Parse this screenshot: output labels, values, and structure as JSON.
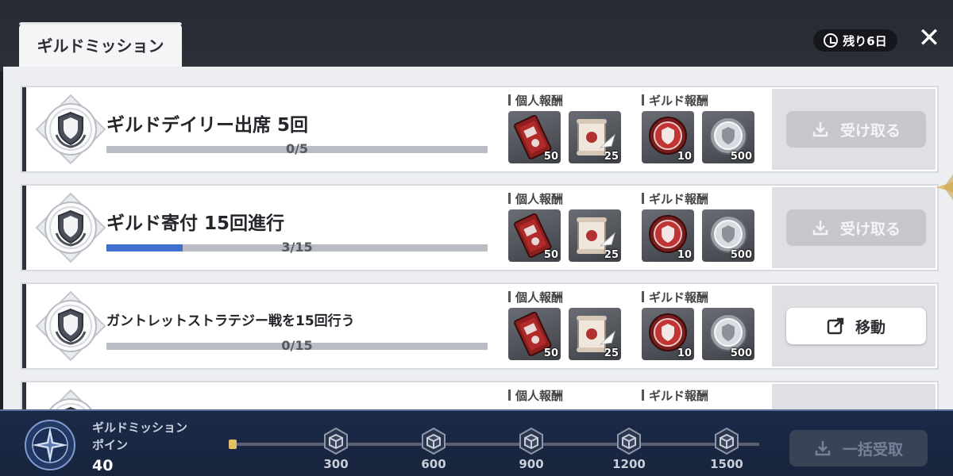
{
  "header": {
    "tab_label": "ギルドミッション",
    "remaining_label": "残り6日"
  },
  "labels": {
    "personal_reward": "個人報酬",
    "guild_reward": "ギルド報酬"
  },
  "missions": [
    {
      "title": "ギルドデイリー出席 5回",
      "progress_text": "0/5",
      "progress_ratio": 0,
      "personal_rewards": [
        {
          "icon": "red-ticket-icon",
          "qty": "50"
        },
        {
          "icon": "scroll-quill-icon",
          "qty": "25"
        }
      ],
      "guild_rewards": [
        {
          "icon": "red-guild-coin-icon",
          "qty": "10"
        },
        {
          "icon": "silver-coin-icon",
          "qty": "500"
        }
      ],
      "action": {
        "label": "受け取る",
        "state": "disabled",
        "icon": "download-icon"
      }
    },
    {
      "title": "ギルド寄付 15回進行",
      "progress_text": "3/15",
      "progress_ratio": 0.2,
      "personal_rewards": [
        {
          "icon": "red-ticket-icon",
          "qty": "50"
        },
        {
          "icon": "scroll-quill-icon",
          "qty": "25"
        }
      ],
      "guild_rewards": [
        {
          "icon": "red-guild-coin-icon",
          "qty": "10"
        },
        {
          "icon": "silver-coin-icon",
          "qty": "500"
        }
      ],
      "action": {
        "label": "受け取る",
        "state": "disabled",
        "icon": "download-icon"
      }
    },
    {
      "title": "ガントレットストラテジー戦を15回行う",
      "progress_text": "0/15",
      "progress_ratio": 0,
      "personal_rewards": [
        {
          "icon": "red-ticket-icon",
          "qty": "50"
        },
        {
          "icon": "scroll-quill-icon",
          "qty": "25"
        }
      ],
      "guild_rewards": [
        {
          "icon": "red-guild-coin-icon",
          "qty": "10"
        },
        {
          "icon": "silver-coin-icon",
          "qty": "500"
        }
      ],
      "action": {
        "label": "移動",
        "state": "active",
        "icon": "external-link-icon"
      }
    }
  ],
  "bottom": {
    "points_label": "ギルドミッションポイン",
    "points_value": "40",
    "milestones": [
      "300",
      "600",
      "900",
      "1200",
      "1500"
    ],
    "claim_all_label": "一括受取"
  },
  "colors": {
    "progress_fill": "#3f6fcf",
    "bottom_bar": "#1a2a48",
    "milestone_knob": "#e3c066"
  }
}
